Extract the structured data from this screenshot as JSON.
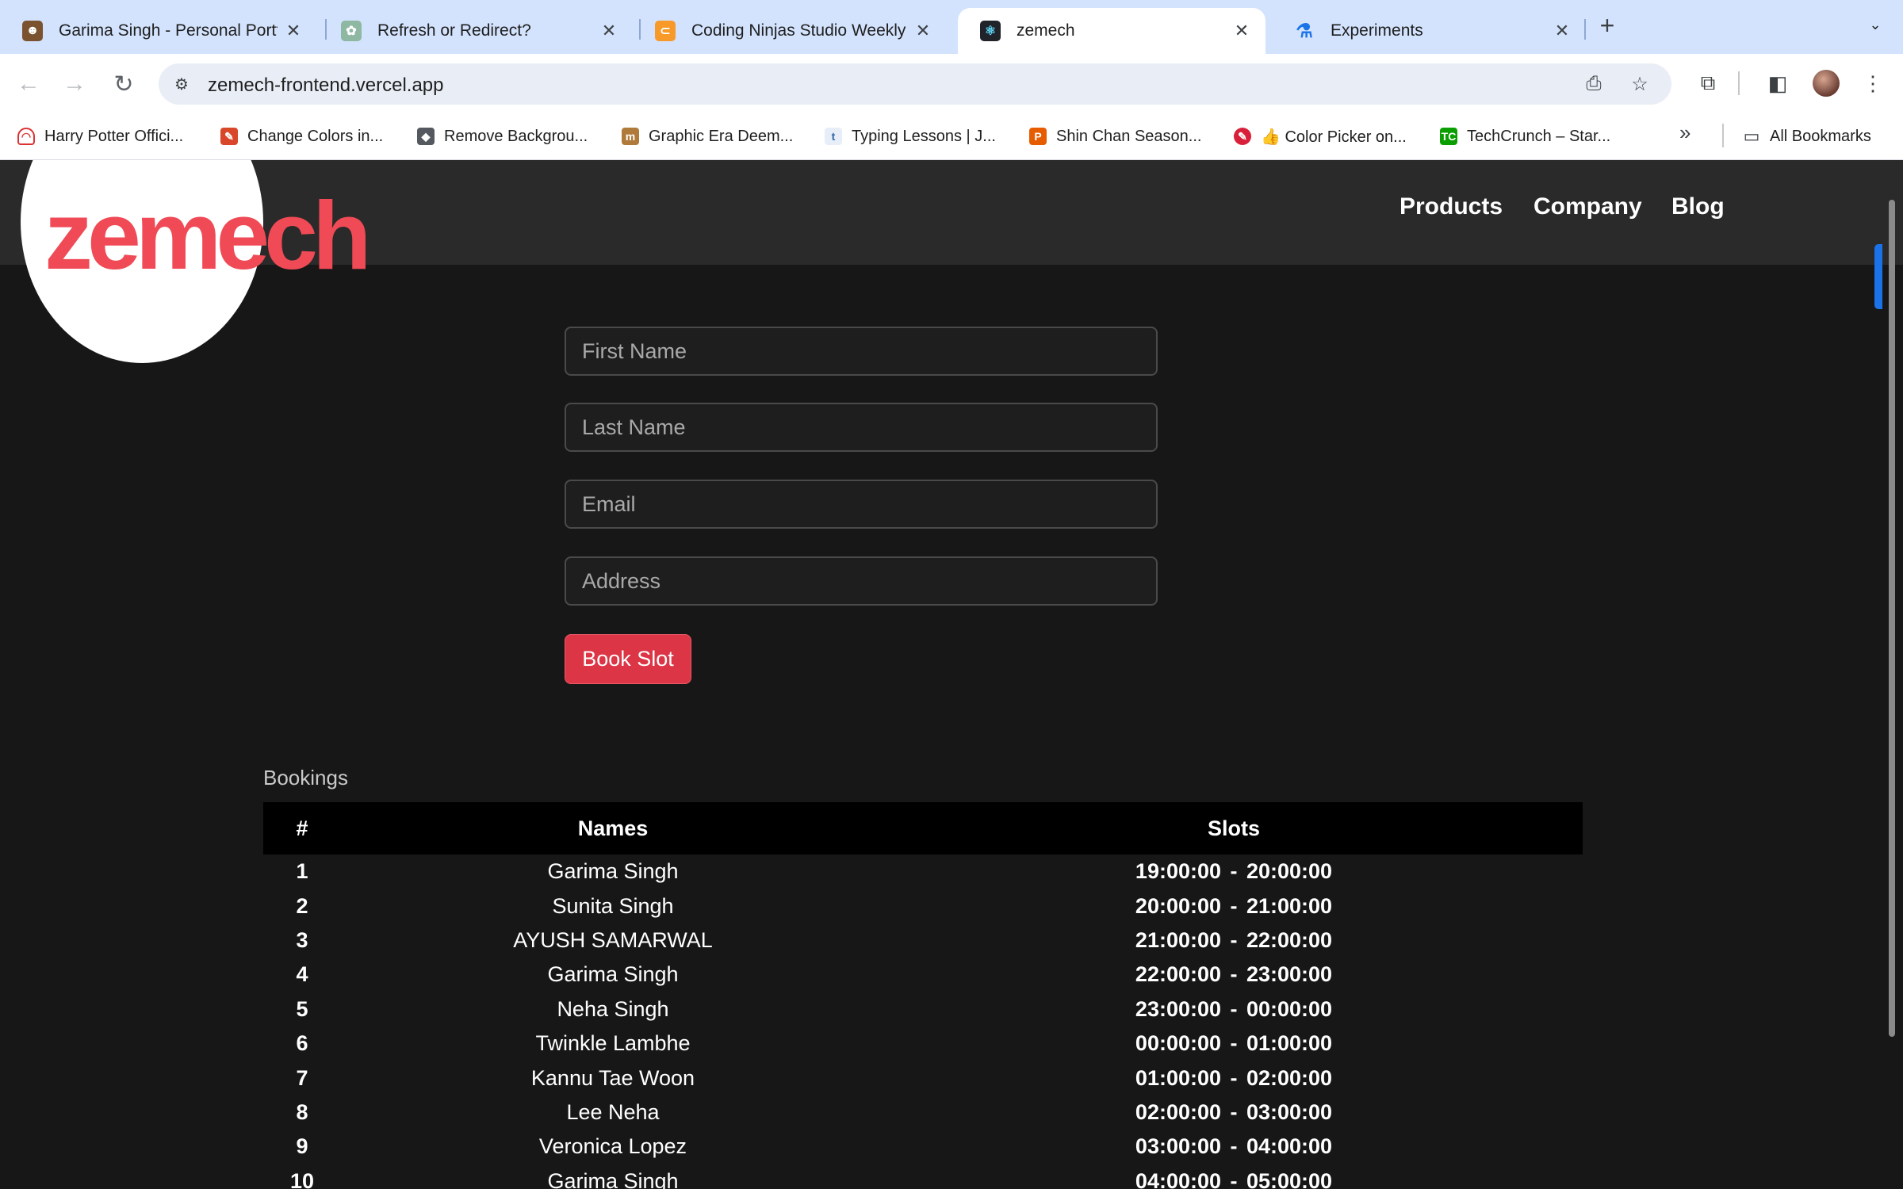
{
  "browser": {
    "tabs": [
      {
        "title": "Garima Singh - Personal Portf",
        "favicon": "avatar-icon",
        "active": false
      },
      {
        "title": "Refresh or Redirect?",
        "favicon": "openai-icon",
        "active": false
      },
      {
        "title": "Coding Ninjas Studio Weekly C",
        "favicon": "coding-ninjas-icon",
        "active": false
      },
      {
        "title": "zemech",
        "favicon": "react-icon",
        "active": true
      },
      {
        "title": "Experiments",
        "favicon": "flask-icon",
        "active": false
      }
    ],
    "url": "zemech-frontend.vercel.app",
    "bookmarks": [
      {
        "label": "Harry Potter Offici...",
        "icon": "ghost-icon"
      },
      {
        "label": "Change Colors in...",
        "icon": "tools-icon"
      },
      {
        "label": "Remove Backgrou...",
        "icon": "layers-icon"
      },
      {
        "label": "Graphic Era Deem...",
        "icon": "university-icon"
      },
      {
        "label": "Typing Lessons | J...",
        "icon": "typing-icon"
      },
      {
        "label": "Shin Chan Season...",
        "icon": "p-icon"
      },
      {
        "label": "👍 Color Picker on...",
        "icon": "eyedropper-icon"
      },
      {
        "label": "TechCrunch – Star...",
        "icon": "techcrunch-icon"
      }
    ],
    "all_bookmarks_label": "All Bookmarks"
  },
  "site": {
    "logo": "zemech",
    "nav": [
      "Products",
      "Company",
      "Blog"
    ],
    "form": {
      "first_name_placeholder": "First Name",
      "last_name_placeholder": "Last Name",
      "email_placeholder": "Email",
      "address_placeholder": "Address",
      "submit_label": "Book Slot"
    },
    "bookings": {
      "label": "Bookings",
      "columns": [
        "#",
        "Names",
        "Slots"
      ],
      "rows": [
        {
          "num": "1",
          "name": "Garima Singh",
          "slot": "19:00:00 - 20:00:00"
        },
        {
          "num": "2",
          "name": "Sunita Singh",
          "slot": "20:00:00 - 21:00:00"
        },
        {
          "num": "3",
          "name": "AYUSH SAMARWAL",
          "slot": "21:00:00 - 22:00:00"
        },
        {
          "num": "4",
          "name": "Garima Singh",
          "slot": "22:00:00 - 23:00:00"
        },
        {
          "num": "5",
          "name": "Neha Singh",
          "slot": "23:00:00 - 00:00:00"
        },
        {
          "num": "6",
          "name": "Twinkle Lambhe",
          "slot": "00:00:00 - 01:00:00"
        },
        {
          "num": "7",
          "name": "Kannu Tae Woon",
          "slot": "01:00:00 - 02:00:00"
        },
        {
          "num": "8",
          "name": "Lee Neha",
          "slot": "02:00:00 - 03:00:00"
        },
        {
          "num": "9",
          "name": "Veronica Lopez",
          "slot": "03:00:00 - 04:00:00"
        },
        {
          "num": "10",
          "name": "Garima Singh",
          "slot": "04:00:00 - 05:00:00"
        }
      ]
    }
  },
  "colors": {
    "brand_red": "#ef4a55",
    "button_red": "#dc3545",
    "page_bg": "#171717",
    "header_bg": "#2a2a2a",
    "tabstrip_bg": "#d3e3fd"
  }
}
